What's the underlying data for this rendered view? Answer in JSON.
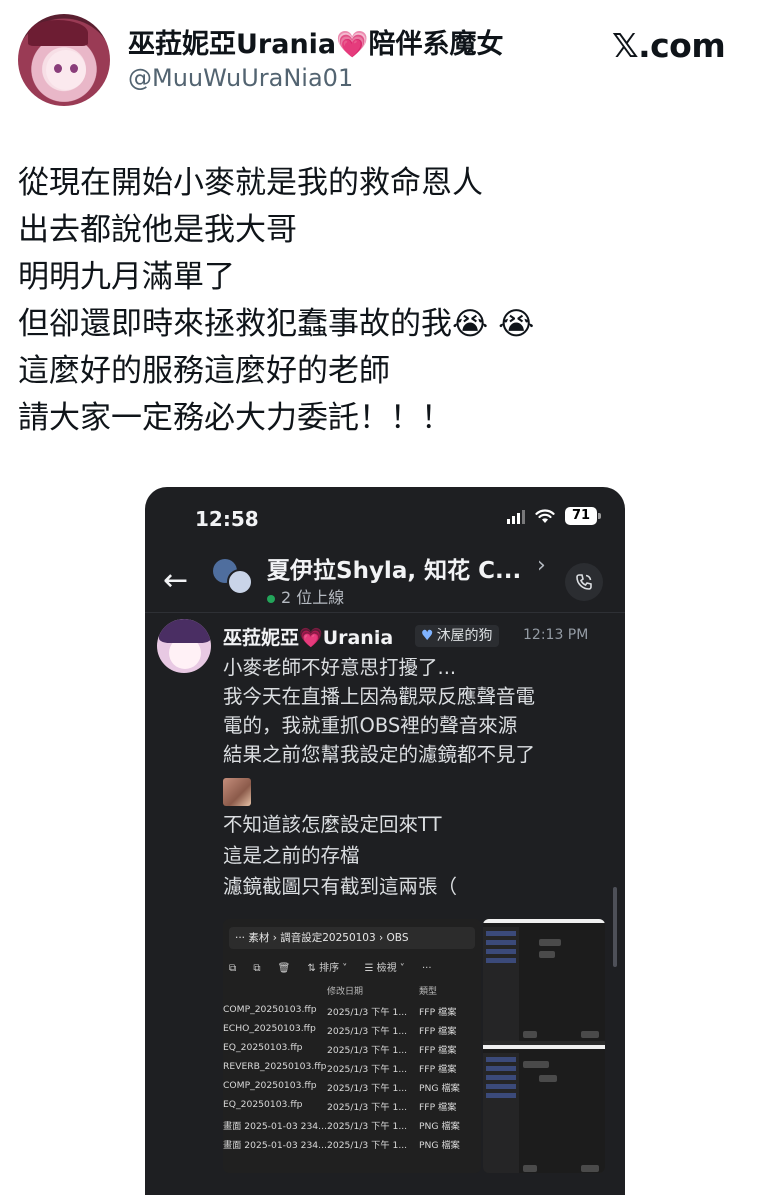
{
  "tweet": {
    "author_name": "巫菈妮亞Urania",
    "author_heart": "💗",
    "author_suffix": "陪伴系魔女",
    "handle": "@MuuWuUraNia01",
    "brand": "𝕏.com",
    "body_lines": [
      "從現在開始小麥就是我的救命恩人",
      "出去都說他是我大哥",
      "明明九月滿單了",
      "但卻還即時來拯救犯蠢事故的我😭 😭",
      "這麼好的服務這麼好的老師",
      "請大家一定務必大力委託！！！"
    ]
  },
  "phone": {
    "status": {
      "time": "12:58",
      "battery": "71"
    },
    "chat": {
      "back": "←",
      "title": "夏伊拉Shyla, 知花 C...",
      "chevron": "›",
      "online": "2 位上線"
    },
    "message": {
      "author": "巫菈妮亞",
      "author_heart": "💗",
      "author_suffix": "Urania",
      "tag": "沐屋的狗",
      "tag_icon": "♥",
      "time": "12:13 PM",
      "lines": [
        "小麥老師不好意思打擾了...",
        "我今天在直播上因為觀眾反應聲音電",
        "電的，我就重抓OBS裡的聲音來源",
        "結果之前您幫我設定的濾鏡都不見了"
      ],
      "lines2": [
        "不知道該怎麼設定回來TT",
        "這是之前的存檔",
        "濾鏡截圖只有截到這兩張（"
      ]
    },
    "explorer": {
      "path": "···   素材   ›   調音設定20250103   ›   OBS",
      "toolbar": [
        "⧉",
        "⧉",
        "🗑",
        "⇅ 排序 ˅",
        "☰ 檢視 ˅",
        "···"
      ],
      "columns": [
        "修改日期",
        "類型"
      ],
      "rows": [
        {
          "name": "COMP_20250103.ffp",
          "date": "2025/1/3 下午 1...",
          "type": "FFP 檔案"
        },
        {
          "name": "ECHO_20250103.ffp",
          "date": "2025/1/3 下午 1...",
          "type": "FFP 檔案"
        },
        {
          "name": "EQ_20250103.ffp",
          "date": "2025/1/3 下午 1...",
          "type": "FFP 檔案"
        },
        {
          "name": "REVERB_20250103.ffp",
          "date": "2025/1/3 下午 1...",
          "type": "FFP 檔案"
        },
        {
          "name": "COMP_20250103.ffp",
          "date": "2025/1/3 下午 1...",
          "type": "PNG 檔案"
        },
        {
          "name": "EQ_20250103.ffp",
          "date": "2025/1/3 下午 1...",
          "type": "FFP 檔案"
        },
        {
          "name": "畫面 2025-01-03 234...",
          "date": "2025/1/3 下午 1...",
          "type": "PNG 檔案"
        },
        {
          "name": "畫面 2025-01-03 234...",
          "date": "2025/1/3 下午 1...",
          "type": "PNG 檔案"
        }
      ]
    }
  }
}
